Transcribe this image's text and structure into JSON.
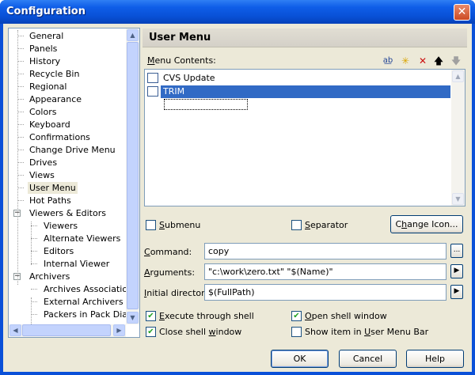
{
  "window": {
    "title": "Configuration",
    "close_glyph": "✕"
  },
  "tree": {
    "items": [
      {
        "label": "General"
      },
      {
        "label": "Panels"
      },
      {
        "label": "History"
      },
      {
        "label": "Recycle Bin"
      },
      {
        "label": "Regional"
      },
      {
        "label": "Appearance"
      },
      {
        "label": "Colors"
      },
      {
        "label": "Keyboard"
      },
      {
        "label": "Confirmations"
      },
      {
        "label": "Change Drive Menu"
      },
      {
        "label": "Drives"
      },
      {
        "label": "Views"
      },
      {
        "label": "User Menu",
        "selected": true
      },
      {
        "label": "Hot Paths"
      },
      {
        "label": "Viewers & Editors",
        "expander": "−"
      },
      {
        "label": "Viewers"
      },
      {
        "label": "Alternate Viewers"
      },
      {
        "label": "Editors"
      },
      {
        "label": "Internal Viewer"
      },
      {
        "label": "Archivers",
        "expander": "−"
      },
      {
        "label": "Archives Associations"
      },
      {
        "label": "External Archivers Lo"
      },
      {
        "label": "Packers in Pack Dialo"
      }
    ]
  },
  "panel": {
    "title": "User Menu",
    "contents_label_pre": "",
    "contents_label_ul": "M",
    "contents_label_post": "enu Contents:",
    "toolbar": {
      "rename_icon": "a͟b",
      "new_icon": "✳",
      "delete_icon": "✕",
      "up_icon": "🡅",
      "down_icon": "🡇"
    },
    "items": [
      {
        "label": "CVS Update"
      },
      {
        "label": "TRIM",
        "selected": true
      }
    ]
  },
  "options": {
    "submenu_ul": "S",
    "submenu_rest": "ubmenu",
    "separator_ul": "S",
    "separator_rest": "eparator",
    "change_icon_pre": "C",
    "change_icon_ul": "h",
    "change_icon_post": "ange Icon...",
    "submenu_checked": false,
    "separator_checked": false
  },
  "fields": {
    "command_ul": "C",
    "command_rest": "ommand:",
    "command_value": "copy",
    "arguments_ul": "A",
    "arguments_rest": "rguments:",
    "arguments_value": "\"c:\\work\\zero.txt\"  \"$(Name)\"",
    "initdir_ul": "I",
    "initdir_rest": "nitial directory:",
    "initdir_value": "$(FullPath)",
    "browse_glyph": "...",
    "arrow_glyph": "▶"
  },
  "checks": {
    "exec_ul": "E",
    "exec_rest": "xecute through shell",
    "exec_checked": true,
    "close_pre": "Close shell ",
    "close_ul": "w",
    "close_rest": "indow",
    "close_checked": true,
    "open_ul": "O",
    "open_rest": "pen shell window",
    "open_checked": true,
    "show_pre": "Show item in ",
    "show_ul": "U",
    "show_rest": "ser Menu Bar",
    "show_checked": false,
    "check_glyph": "✔"
  },
  "buttons": {
    "ok": "OK",
    "cancel": "Cancel",
    "help": "Help"
  },
  "scroll": {
    "up": "▲",
    "down": "▼",
    "left": "◀",
    "right": "▶"
  }
}
